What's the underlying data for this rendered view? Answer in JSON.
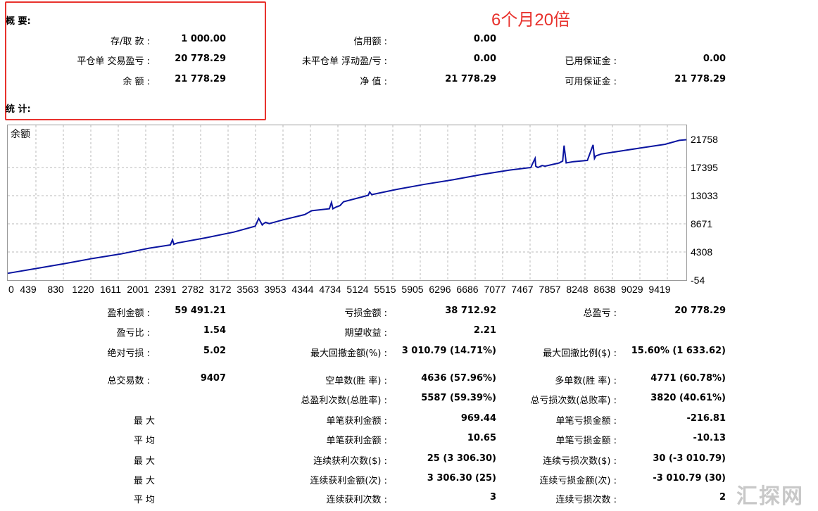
{
  "summary": {
    "header": "概 要:",
    "deposit_label": "存/取 款 :",
    "deposit_value": "1 000.00",
    "closed_pl_label": "平仓单 交易盈亏 :",
    "closed_pl_value": "20 778.29",
    "balance_label": "余 额 :",
    "balance_value": "21 778.29",
    "credit_label": "信用额 :",
    "credit_value": "0.00",
    "floating_pl_label": "未平仓单 浮动盈/亏 :",
    "floating_pl_value": "0.00",
    "equity_label": "净 值 :",
    "equity_value": "21 778.29",
    "margin_label": "已用保证金 :",
    "margin_value": "0.00",
    "free_margin_label": "可用保证金 :",
    "free_margin_value": "21 778.29"
  },
  "annotation": "6个月20倍",
  "stats_header": "统 计:",
  "chart_data": {
    "type": "line",
    "title": "余额",
    "y_ticks": [
      "21758",
      "17395",
      "13033",
      "8671",
      "4308",
      "-54"
    ],
    "x_ticks": [
      "0",
      "439",
      "830",
      "1220",
      "1611",
      "2001",
      "2391",
      "2782",
      "3172",
      "3563",
      "3953",
      "4344",
      "4734",
      "5124",
      "5515",
      "5905",
      "6296",
      "6686",
      "7077",
      "7467",
      "7857",
      "8248",
      "8638",
      "9029",
      "9419"
    ],
    "ylim": [
      -54,
      21758
    ],
    "xlim": [
      0,
      9600
    ],
    "grid": true,
    "color": "#0a14a0",
    "series": [
      {
        "x": [
          0,
          400,
          800,
          1200,
          1600,
          2000,
          2300,
          2330,
          2350,
          2400,
          2800,
          3200,
          3500,
          3550,
          3600,
          3620,
          3650,
          3700,
          3900,
          4200,
          4300,
          4550,
          4580,
          4600,
          4650,
          4700,
          4750,
          5000,
          5100,
          5120,
          5150,
          5500,
          5900,
          6300,
          6700,
          7100,
          7400,
          7420,
          7460,
          7470,
          7500,
          7560,
          7600,
          7800,
          7850,
          7870,
          7900,
          8000,
          8200,
          8280,
          8300,
          8320,
          8400,
          8700,
          9000,
          9300,
          9500,
          9600
        ],
        "y": [
          1000,
          1750,
          2500,
          3300,
          4000,
          4900,
          5400,
          6200,
          5500,
          5700,
          6500,
          7400,
          8300,
          9500,
          8500,
          8700,
          8900,
          8700,
          9300,
          10100,
          10700,
          11000,
          12000,
          11000,
          11300,
          11500,
          12100,
          12800,
          13100,
          13600,
          13200,
          14000,
          14800,
          15500,
          16300,
          17000,
          17400,
          17900,
          18800,
          17600,
          17400,
          17700,
          17600,
          18100,
          18400,
          20800,
          18100,
          18300,
          18500,
          20900,
          18800,
          19200,
          19500,
          20000,
          20500,
          21000,
          21600,
          21700
        ]
      }
    ]
  },
  "stats": {
    "gross_profit_label": "盈利金额 :",
    "gross_profit_value": "59 491.21",
    "gross_loss_label": "亏损金额 :",
    "gross_loss_value": "38 712.92",
    "total_pl_label": "总盈亏 :",
    "total_pl_value": "20 778.29",
    "profit_factor_label": "盈亏比 :",
    "profit_factor_value": "1.54",
    "expected_payoff_label": "期望收益 :",
    "expected_payoff_value": "2.21",
    "abs_drawdown_label": "绝对亏损 :",
    "abs_drawdown_value": "5.02",
    "max_drawdown_label": "最大回撤金额(%) :",
    "max_drawdown_value": "3 010.79 (14.71%)",
    "rel_drawdown_label": "最大回撤比例($) :",
    "rel_drawdown_value": "15.60% (1 633.62)",
    "total_trades_label": "总交易数 :",
    "total_trades_value": "9407",
    "short_label": "空单数(胜 率) :",
    "short_value": "4636 (57.96%)",
    "long_label": "多单数(胜 率) :",
    "long_value": "4771 (60.78%)",
    "win_count_label": "总盈利次数(总胜率) :",
    "win_count_value": "5587 (59.39%)",
    "loss_count_label": "总亏损次数(总败率) :",
    "loss_count_value": "3820 (40.61%)",
    "largest_label": "最 大",
    "largest_win_label": "单笔获利金额 :",
    "largest_win_value": "969.44",
    "largest_loss_label": "单笔亏损金额 :",
    "largest_loss_value": "-216.81",
    "average_label": "平 均",
    "avg_win_label": "单笔获利金额 :",
    "avg_win_value": "10.65",
    "avg_loss_label": "单笔亏损金额 :",
    "avg_loss_value": "-10.13",
    "max_label": "最 大",
    "max_consec_wins_label": "连续获利次数($) :",
    "max_consec_wins_value": "25 (3 306.30)",
    "max_consec_losses_label": "连续亏损次数($) :",
    "max_consec_losses_value": "30 (-3 010.79)",
    "max2_label": "最 大",
    "max_consec_profit_label": "连续获利金额(次) :",
    "max_consec_profit_value": "3 306.30 (25)",
    "max_consec_loss_label": "连续亏损金额(次) :",
    "max_consec_loss_value": "-3 010.79 (30)",
    "avg2_label": "平 均",
    "avg_consec_wins_label": "连续获利次数 :",
    "avg_consec_wins_value": "3",
    "avg_consec_losses_label": "连续亏损次数 :",
    "avg_consec_losses_value": "2"
  },
  "watermark": "汇探网"
}
